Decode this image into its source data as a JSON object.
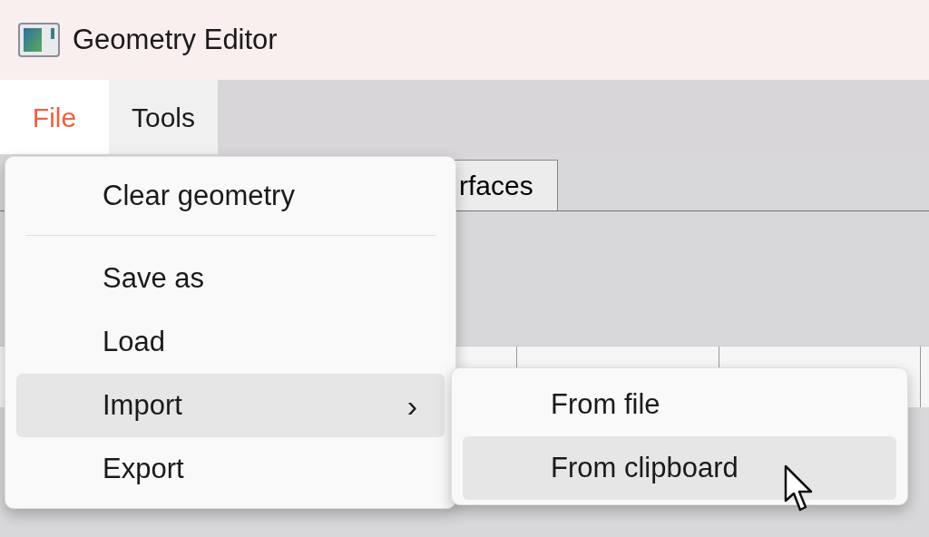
{
  "window": {
    "title": "Geometry Editor"
  },
  "menu_bar": [
    {
      "label": "File",
      "selected": true
    },
    {
      "label": "Tools",
      "selected": false
    }
  ],
  "tabs": [
    {
      "label": "rfaces"
    }
  ],
  "file_menu": [
    {
      "kind": "item",
      "label": "Clear geometry",
      "selected": false
    },
    {
      "kind": "separator"
    },
    {
      "kind": "item",
      "label": "Save as",
      "selected": false
    },
    {
      "kind": "item",
      "label": "Load",
      "selected": false
    },
    {
      "kind": "submenu",
      "label": "Import",
      "arrow": "›",
      "selected": true
    },
    {
      "kind": "item",
      "label": "Export",
      "selected": false
    }
  ],
  "import_submenu": [
    {
      "label": "From file",
      "selected": false
    },
    {
      "label": "From clipboard",
      "selected": true
    }
  ]
}
